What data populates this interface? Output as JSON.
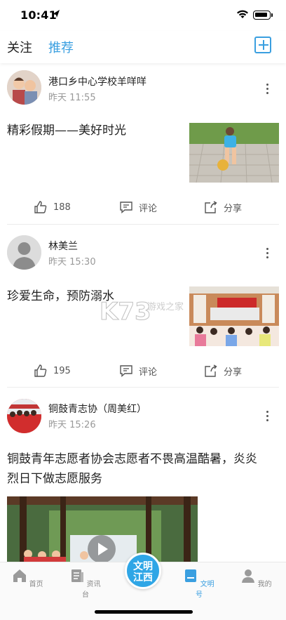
{
  "status_bar": {
    "time": "10:41"
  },
  "top_nav": {
    "tab_follow": "关注",
    "tab_recommend": "推荐",
    "accent": "#3a9fe0"
  },
  "posts": [
    {
      "author": "港口乡中心学校羊咩咩",
      "time": "昨天 11:55",
      "title": "精彩假期——美好时光",
      "likes": "188",
      "comment": "评论",
      "share": "分享"
    },
    {
      "author": "林美兰",
      "time": "昨天 15:30",
      "title": "珍爱生命，预防溺水",
      "likes": "195",
      "comment": "评论",
      "share": "分享",
      "thumb_banner": "溺水宣传"
    },
    {
      "author": "铜鼓青志协（周美红）",
      "time": "昨天 15:26",
      "title_line1": "铜鼓青年志愿者协会志愿者不畏高温酷暑，炎炎",
      "title_line2": "烈日下做志愿服务"
    }
  ],
  "watermark": {
    "logo": "K73",
    "sub": "游戏之家"
  },
  "bottom_nav": {
    "home": "首页",
    "news": "资讯台",
    "center_line1": "文明",
    "center_line2": "江西",
    "wenming": "文明号",
    "mine": "我的"
  }
}
